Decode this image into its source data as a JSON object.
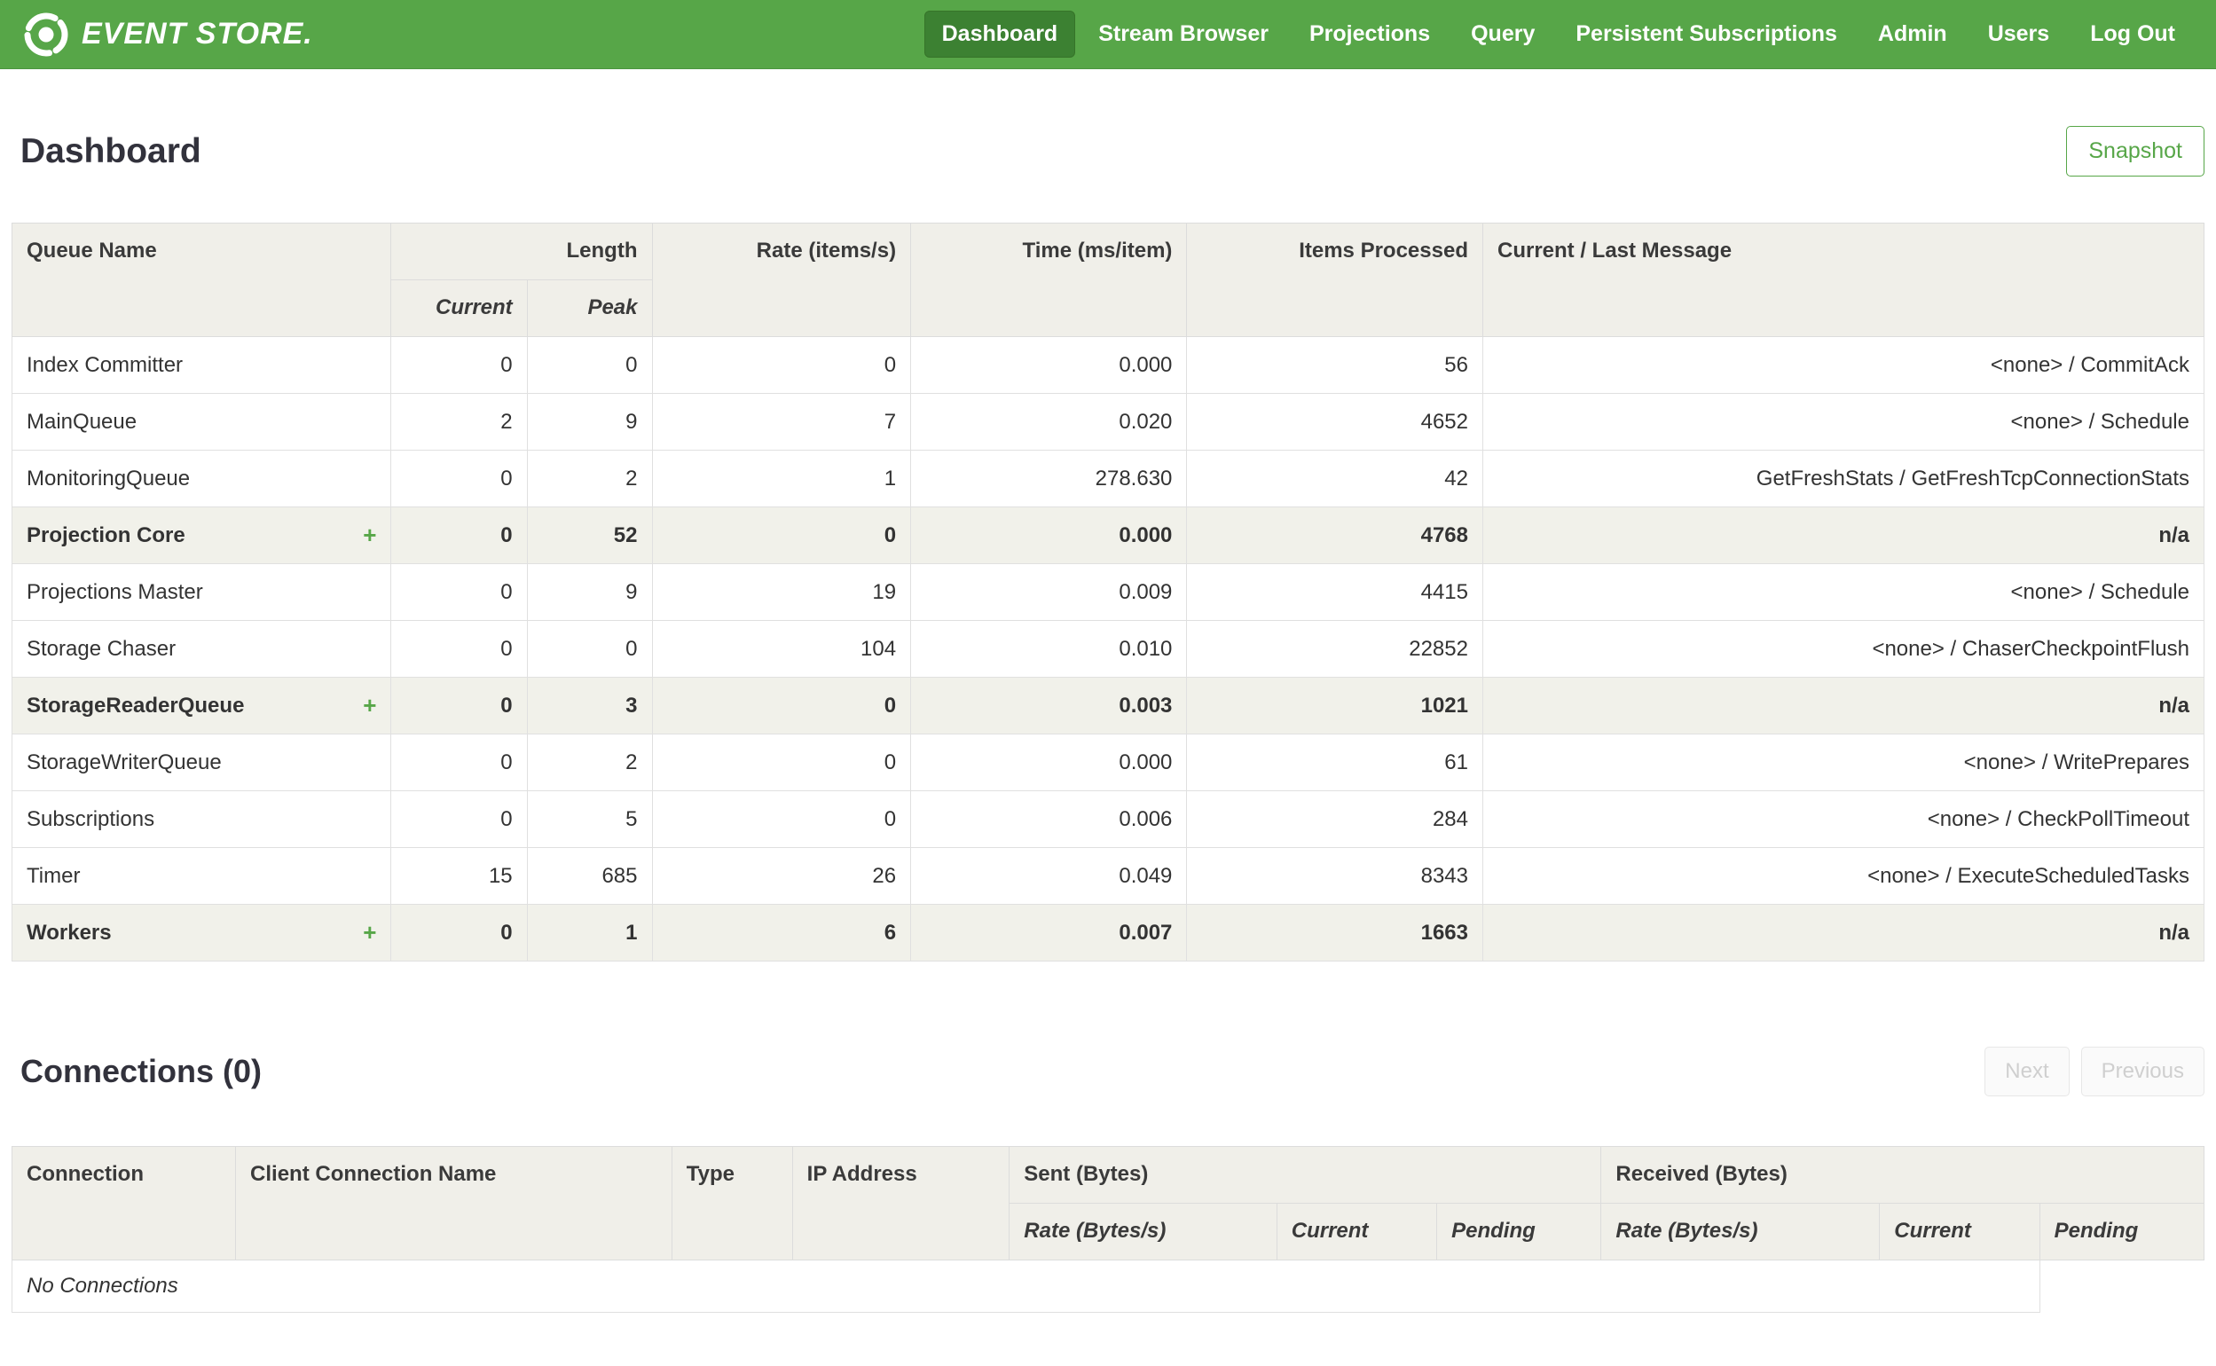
{
  "colors": {
    "navbar_green": "#57a648",
    "active_nav_green": "#3c8132",
    "accent_green": "#57a648",
    "table_header_bg": "#f0efe9",
    "group_row_bg": "#f1f1ea"
  },
  "navbar": {
    "brand": "EVENT STORE.",
    "items": [
      {
        "label": "Dashboard",
        "active": true
      },
      {
        "label": "Stream Browser",
        "active": false
      },
      {
        "label": "Projections",
        "active": false
      },
      {
        "label": "Query",
        "active": false
      },
      {
        "label": "Persistent Subscriptions",
        "active": false
      },
      {
        "label": "Admin",
        "active": false
      },
      {
        "label": "Users",
        "active": false
      },
      {
        "label": "Log Out",
        "active": false
      }
    ]
  },
  "page": {
    "title": "Dashboard",
    "snapshot_button": "Snapshot"
  },
  "queues_table": {
    "expander_symbol": "+",
    "headers": {
      "queue_name": "Queue Name",
      "length": "Length",
      "current": "Current",
      "peak": "Peak",
      "rate": "Rate (items/s)",
      "time": "Time (ms/item)",
      "items_processed": "Items Processed",
      "message": "Current / Last Message"
    },
    "rows": [
      {
        "name": "Index Committer",
        "group": false,
        "current": "0",
        "peak": "0",
        "rate": "0",
        "time": "0.000",
        "items": "56",
        "message": "<none> / CommitAck"
      },
      {
        "name": "MainQueue",
        "group": false,
        "current": "2",
        "peak": "9",
        "rate": "7",
        "time": "0.020",
        "items": "4652",
        "message": "<none> / Schedule"
      },
      {
        "name": "MonitoringQueue",
        "group": false,
        "current": "0",
        "peak": "2",
        "rate": "1",
        "time": "278.630",
        "items": "42",
        "message": "GetFreshStats / GetFreshTcpConnectionStats"
      },
      {
        "name": "Projection Core",
        "group": true,
        "current": "0",
        "peak": "52",
        "rate": "0",
        "time": "0.000",
        "items": "4768",
        "message": "n/a"
      },
      {
        "name": "Projections Master",
        "group": false,
        "current": "0",
        "peak": "9",
        "rate": "19",
        "time": "0.009",
        "items": "4415",
        "message": "<none> / Schedule"
      },
      {
        "name": "Storage Chaser",
        "group": false,
        "current": "0",
        "peak": "0",
        "rate": "104",
        "time": "0.010",
        "items": "22852",
        "message": "<none> / ChaserCheckpointFlush"
      },
      {
        "name": "StorageReaderQueue",
        "group": true,
        "current": "0",
        "peak": "3",
        "rate": "0",
        "time": "0.003",
        "items": "1021",
        "message": "n/a"
      },
      {
        "name": "StorageWriterQueue",
        "group": false,
        "current": "0",
        "peak": "2",
        "rate": "0",
        "time": "0.000",
        "items": "61",
        "message": "<none> / WritePrepares"
      },
      {
        "name": "Subscriptions",
        "group": false,
        "current": "0",
        "peak": "5",
        "rate": "0",
        "time": "0.006",
        "items": "284",
        "message": "<none> / CheckPollTimeout"
      },
      {
        "name": "Timer",
        "group": false,
        "current": "15",
        "peak": "685",
        "rate": "26",
        "time": "0.049",
        "items": "8343",
        "message": "<none> / ExecuteScheduledTasks"
      },
      {
        "name": "Workers",
        "group": true,
        "current": "0",
        "peak": "1",
        "rate": "6",
        "time": "0.007",
        "items": "1663",
        "message": "n/a"
      }
    ]
  },
  "connections": {
    "title": "Connections (0)",
    "next_button": "Next",
    "previous_button": "Previous",
    "headers": {
      "connection": "Connection",
      "client_connection_name": "Client Connection Name",
      "type": "Type",
      "ip_address": "IP Address",
      "sent": "Sent (Bytes)",
      "received": "Received (Bytes)",
      "rate": "Rate (Bytes/s)",
      "current": "Current",
      "pending": "Pending"
    },
    "empty_message": "No Connections"
  }
}
